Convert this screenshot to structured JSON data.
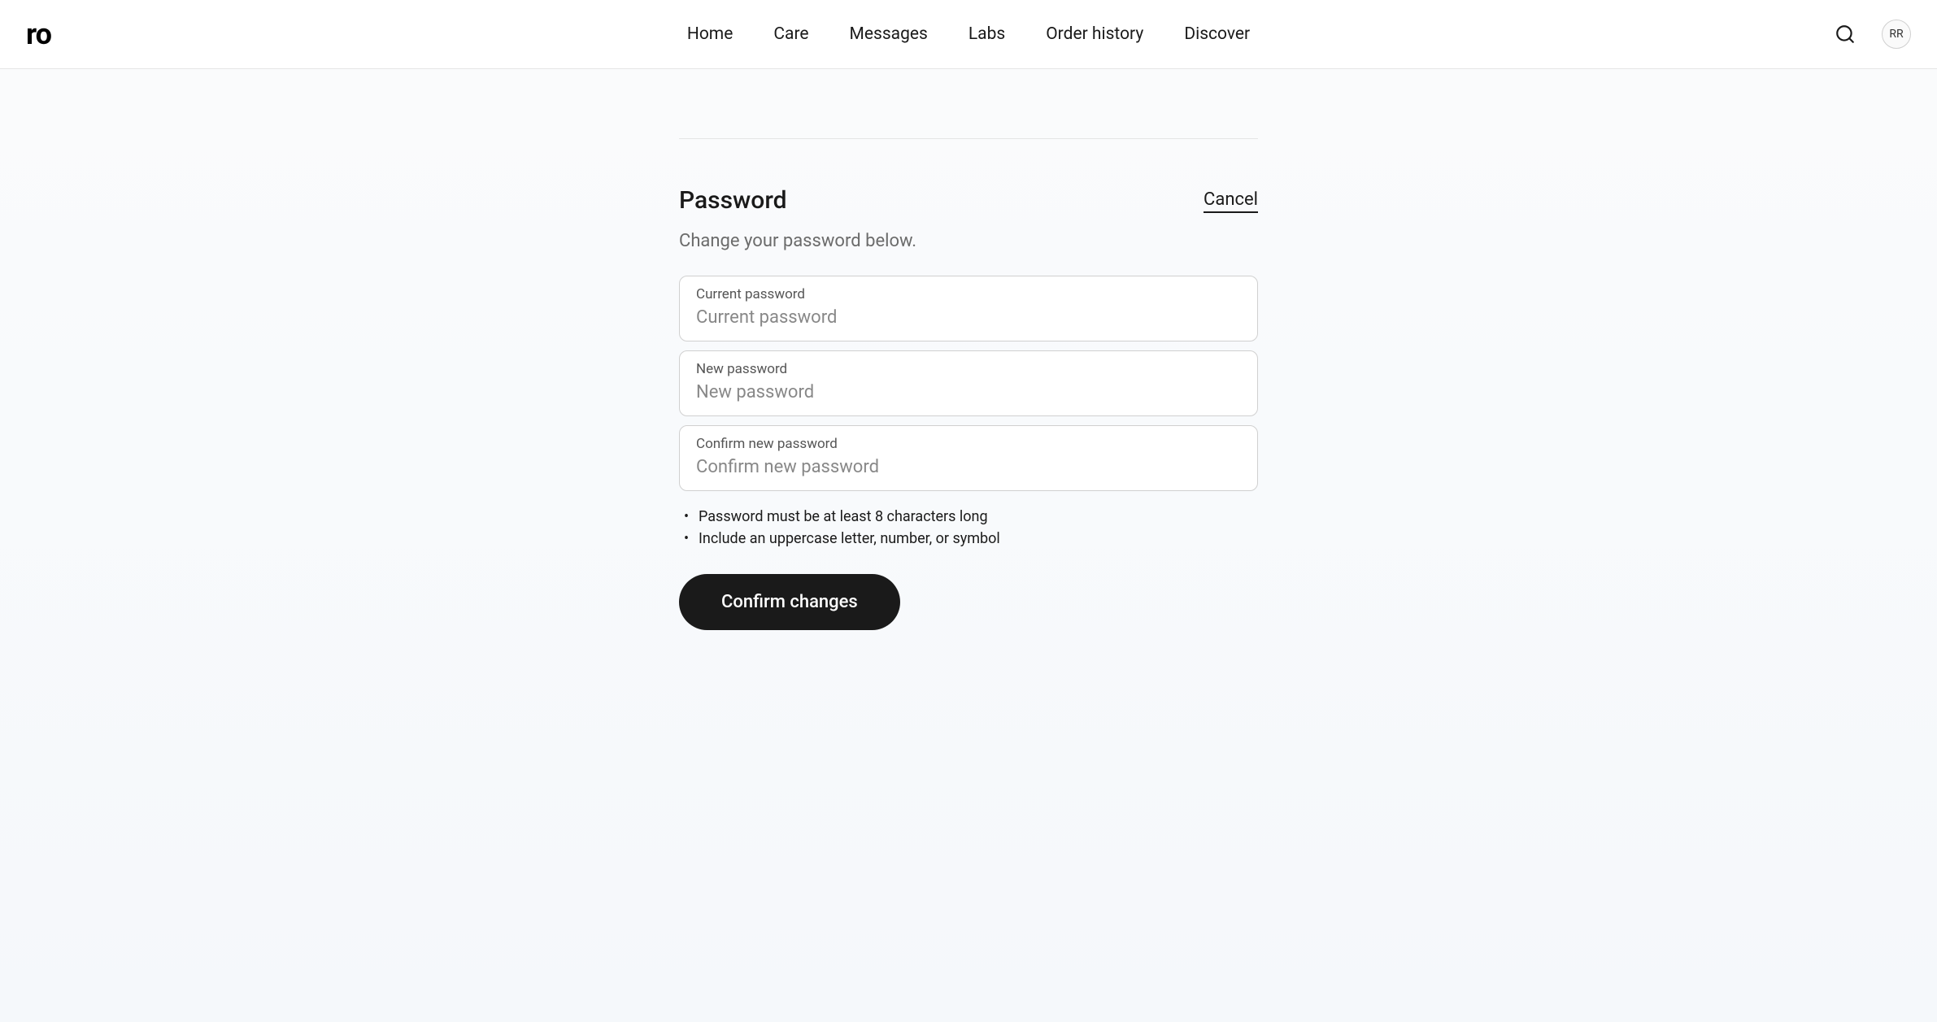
{
  "header": {
    "logo": "ro",
    "nav": {
      "home": "Home",
      "care": "Care",
      "messages": "Messages",
      "labs": "Labs",
      "order_history": "Order history",
      "discover": "Discover"
    },
    "avatar_initials": "RR"
  },
  "password_section": {
    "title": "Password",
    "cancel_label": "Cancel",
    "subtitle": "Change your password below.",
    "fields": {
      "current": {
        "label": "Current password",
        "placeholder": "Current password"
      },
      "new": {
        "label": "New password",
        "placeholder": "New password"
      },
      "confirm": {
        "label": "Confirm new password",
        "placeholder": "Confirm new password"
      }
    },
    "requirements": [
      "Password must be at least 8 characters long",
      "Include an uppercase letter, number, or symbol"
    ],
    "confirm_button": "Confirm changes"
  }
}
